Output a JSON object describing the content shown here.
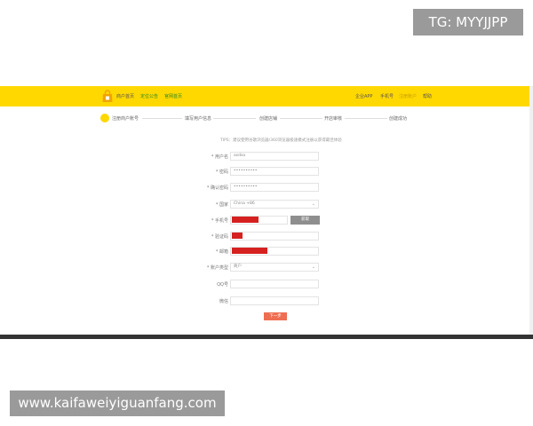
{
  "watermarks": {
    "top": "TG: MYYJJPP",
    "bottom": "www.kaifaweiyiguanfang.com"
  },
  "colors": {
    "header": "#ffd800",
    "submit": "#ee6e52",
    "redaction": "#d62121",
    "code_button": "#8e8e8e"
  },
  "header": {
    "logo": "shopping-bag-icon",
    "nav": [
      {
        "label": "商户首页",
        "active": false
      },
      {
        "label": "定位公告",
        "active": true
      },
      {
        "label": "官网首页",
        "active": true
      }
    ],
    "right": [
      {
        "label": "企业APP",
        "highlight": false
      },
      {
        "label": "手机号",
        "highlight": false
      },
      {
        "label": "注册账户",
        "highlight": true
      },
      {
        "label": "帮助",
        "highlight": false
      }
    ]
  },
  "steps": [
    {
      "label": "注册商户账号"
    },
    {
      "label": "填写用户信息"
    },
    {
      "label": "创建店铺"
    },
    {
      "label": "开店审核"
    },
    {
      "label": "创建成功"
    }
  ],
  "notice": "TIPS：建议使用谷歌浏览器/360浏览器极速模式注册以获得最佳体验",
  "form": {
    "username": {
      "label": "* 用户名",
      "value": "asdsa"
    },
    "password": {
      "label": "* 密码",
      "value": "••••••••••"
    },
    "confirm": {
      "label": "* 确认密码",
      "value": "••••••••••"
    },
    "country": {
      "label": "* 国家",
      "value": "China +86"
    },
    "phone": {
      "label": "* 手机号"
    },
    "code_button": "获取",
    "sms_code": {
      "label": "* 验证码"
    },
    "email": {
      "label": "* 邮箱"
    },
    "account_type": {
      "label": "* 账户类型",
      "value": "商户"
    },
    "qq": {
      "label": "QQ号"
    },
    "wechat": {
      "label": "微信"
    },
    "submit": "下一步"
  }
}
